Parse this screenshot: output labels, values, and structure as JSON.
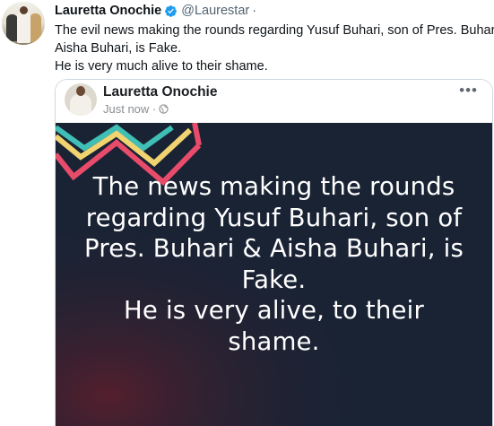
{
  "tweet": {
    "author_name": "Lauretta Onochie",
    "handle": "@Laurestar",
    "separator": "·",
    "verified_icon": "verified-badge-icon",
    "text_lines": [
      "The evil news making the rounds regarding Yusuf Buhari, son of Pres. Buhari &",
      "Aisha Buhari, is Fake.",
      "He is very much alive to their shame."
    ]
  },
  "embedded_post": {
    "author_name": "Lauretta Onochie",
    "timestamp": "Just now ·",
    "privacy_icon": "globe-icon",
    "more_icon": "•••",
    "image_text_lines": [
      "The news making the rounds",
      "regarding Yusuf Buhari, son of",
      "Pres. Buhari & Aisha Buhari, is",
      "Fake.",
      "He is very alive, to their",
      "shame."
    ]
  },
  "colors": {
    "verified": "#1d9bf0",
    "post_background": "#1a2334",
    "chevron_pink": "#e94b6b",
    "chevron_yellow": "#f1d36f",
    "chevron_teal": "#3fbfb5"
  }
}
